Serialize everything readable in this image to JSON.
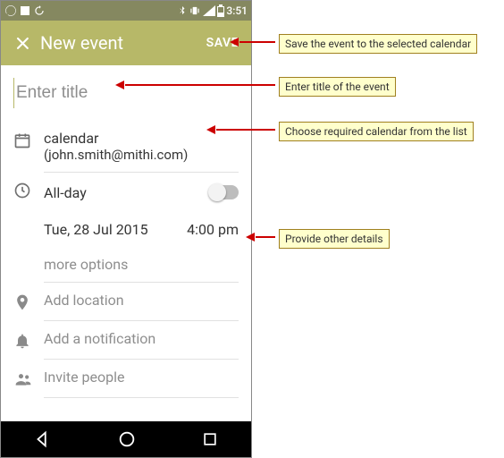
{
  "statusbar": {
    "time": "3:51"
  },
  "header": {
    "title": "New event",
    "save_label": "SAVE"
  },
  "title_field": {
    "placeholder": "Enter title",
    "value": ""
  },
  "calendar": {
    "name": "calendar",
    "account": "(john.smith@mithi.com)"
  },
  "allday": {
    "label": "All-day",
    "on": false
  },
  "datetime": {
    "date": "Tue, 28 Jul 2015",
    "time": "4:00 pm"
  },
  "more_options": "more options",
  "location": {
    "placeholder": "Add location"
  },
  "notification": {
    "placeholder": "Add a notification"
  },
  "invite": {
    "placeholder": "Invite people"
  },
  "annotations": {
    "save": "Save the event to the selected calendar",
    "title": "Enter title of the event",
    "calendar": "Choose required calendar from the list",
    "details": "Provide other details"
  }
}
